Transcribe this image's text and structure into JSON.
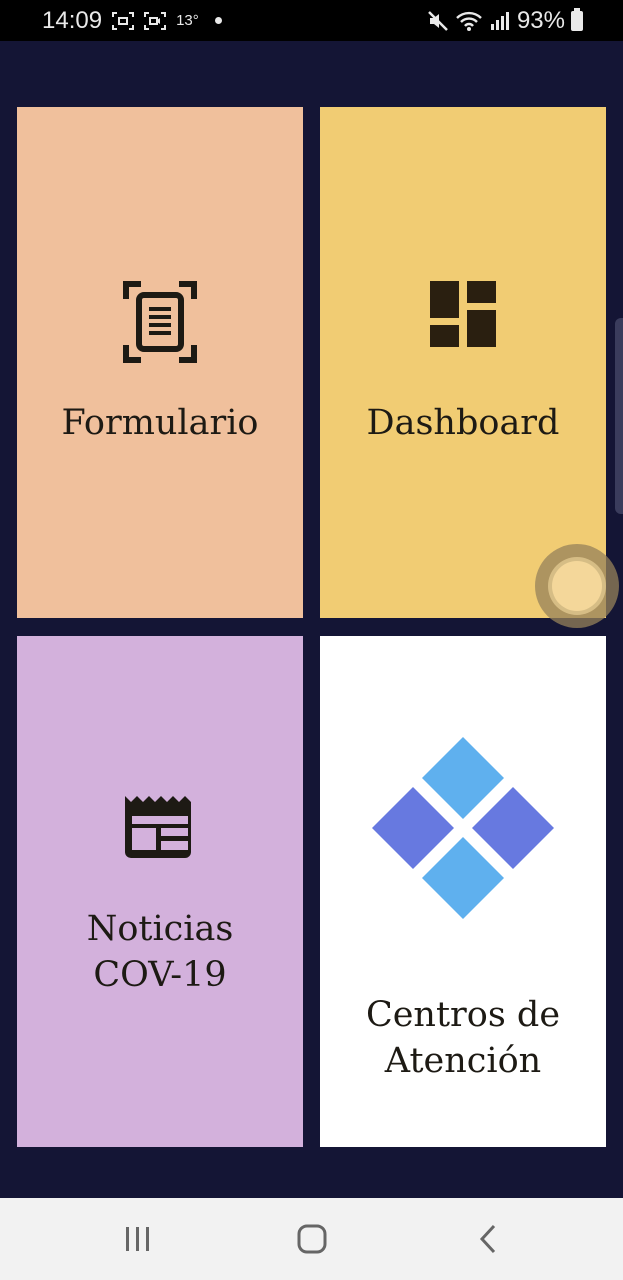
{
  "status_bar": {
    "time": "14:09",
    "temperature": "13°",
    "battery": "93%",
    "icons": [
      "screenshot-icon",
      "screen-record-icon",
      "mute-icon",
      "wifi-icon",
      "signal-icon",
      "battery-icon"
    ]
  },
  "tiles": [
    {
      "label": "Formulario",
      "icon": "document-scan-icon",
      "color": "#f0c09c"
    },
    {
      "label": "Dashboard",
      "icon": "dashboard-icon",
      "color": "#f1cc73"
    },
    {
      "label": "Noticias\nCOV-19",
      "icon": "newspaper-icon",
      "color": "#d3b1dc"
    },
    {
      "label": "Centros de\nAtención",
      "icon": "diamond-logo-icon",
      "color": "#ffffff"
    }
  ],
  "navigation": {
    "buttons": [
      "recent-apps",
      "home",
      "back"
    ]
  },
  "colors": {
    "background": "#141535",
    "status_bar": "#000000",
    "nav_bar": "#f2f2f2",
    "logo_light": "#5fb0ee",
    "logo_dark": "#6779e0"
  }
}
